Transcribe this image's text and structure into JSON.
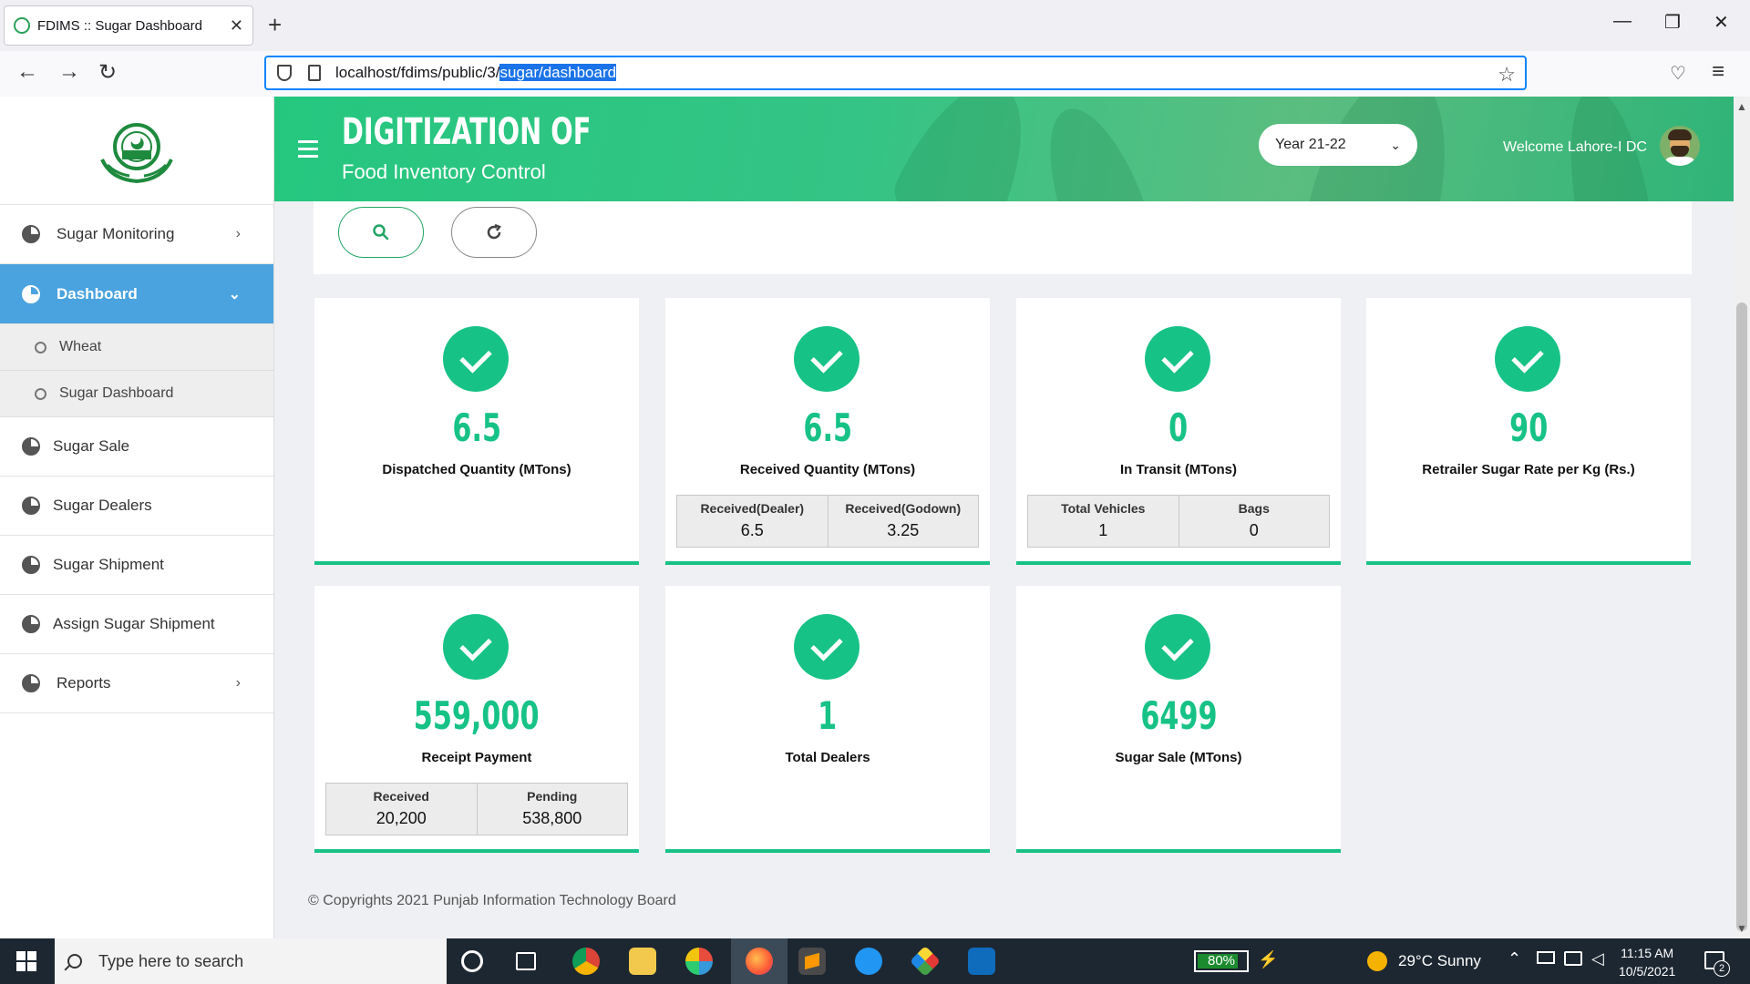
{
  "browser": {
    "tab_title": "FDIMS :: Sugar Dashboard",
    "tab_close": "✕",
    "new_tab": "+",
    "url_plain": "localhost/fdims/public/3/",
    "url_selected": "sugar/dashboard"
  },
  "sidebar": {
    "items": [
      {
        "label": "Sugar Monitoring"
      },
      {
        "label": "Dashboard"
      },
      {
        "label": "Sugar Sale"
      },
      {
        "label": "Sugar Dealers"
      },
      {
        "label": "Sugar Shipment"
      },
      {
        "label": "Assign Sugar Shipment"
      },
      {
        "label": "Reports"
      }
    ],
    "sub_items": [
      {
        "label": "Wheat"
      },
      {
        "label": "Sugar Dashboard"
      }
    ]
  },
  "header": {
    "title": "DIGITIZATION OF",
    "subtitle": "Food Inventory Control",
    "year_selected": "Year 21-22",
    "welcome": "Welcome Lahore-I DC"
  },
  "cards": [
    {
      "value": "6.5",
      "label": "Dispatched Quantity (MTons)"
    },
    {
      "value": "6.5",
      "label": "Received Quantity (MTons)",
      "sub": [
        {
          "header": "Received(Dealer)",
          "value": "6.5"
        },
        {
          "header": "Received(Godown)",
          "value": "3.25"
        }
      ]
    },
    {
      "value": "0",
      "label": "In Transit (MTons)",
      "sub": [
        {
          "header": "Total Vehicles",
          "value": "1"
        },
        {
          "header": "Bags",
          "value": "0"
        }
      ]
    },
    {
      "value": "90",
      "label": "Retrailer Sugar Rate per Kg (Rs.)"
    },
    {
      "value": "559,000",
      "label": "Receipt Payment",
      "sub": [
        {
          "header": "Received",
          "value": "20,200"
        },
        {
          "header": "Pending",
          "value": "538,800"
        }
      ]
    },
    {
      "value": "1",
      "label": "Total Dealers"
    },
    {
      "value": "6499",
      "label": "Sugar Sale (MTons)"
    }
  ],
  "footer": {
    "text": "© Copyrights 2021 Punjab Information Technology Board"
  },
  "taskbar": {
    "search_placeholder": "Type here to search",
    "battery": "80%",
    "weather": "29°C  Sunny",
    "time": "11:15 AM",
    "date": "10/5/2021",
    "notifications": "2"
  },
  "colors": {
    "accent_green": "#17c286",
    "sidebar_active": "#4aa3df",
    "header_green": "#25c77f"
  }
}
